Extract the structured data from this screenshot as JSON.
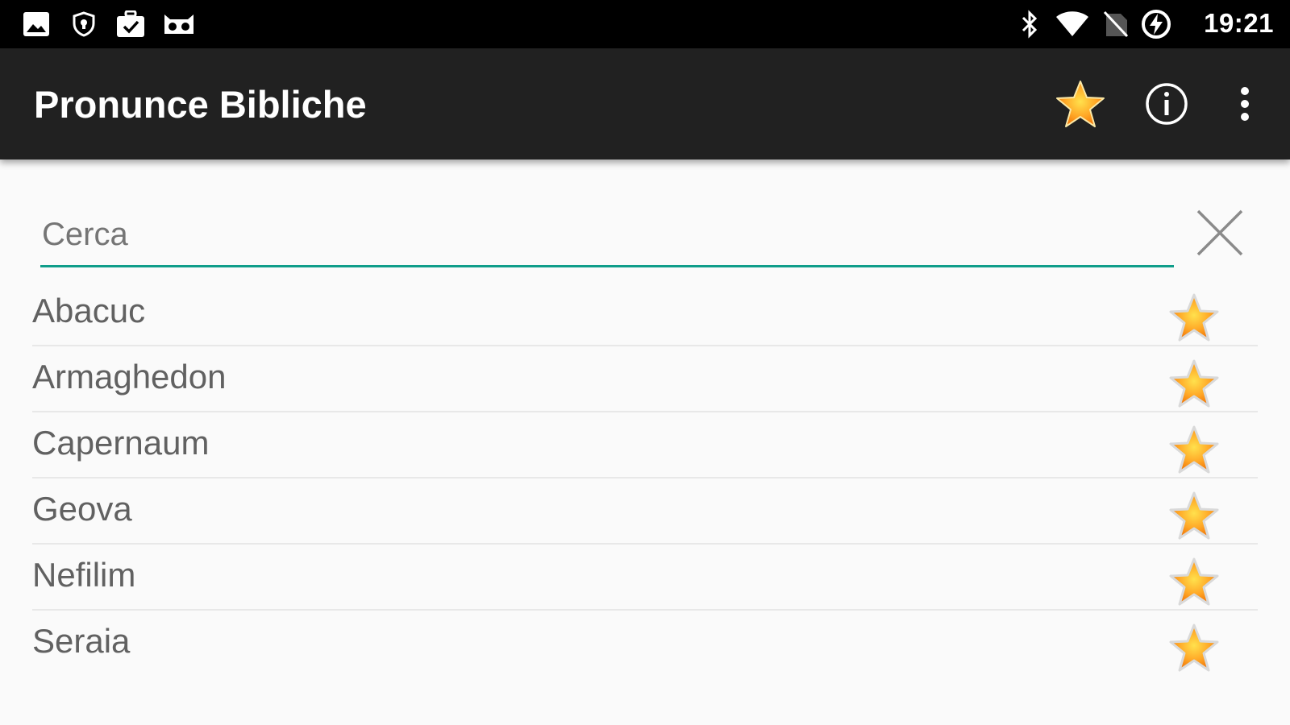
{
  "status_bar": {
    "time": "19:21",
    "left_icons": [
      "image-icon",
      "shield-icon",
      "briefcase-check-icon",
      "cat-face-icon"
    ],
    "right_icons": [
      "bluetooth-icon",
      "wifi-icon",
      "no-sim-icon",
      "battery-charging-icon"
    ]
  },
  "app_bar": {
    "title": "Pronunce Bibliche",
    "actions": [
      "star-icon",
      "info-icon",
      "overflow-menu-icon"
    ]
  },
  "search": {
    "placeholder": "Cerca",
    "value": ""
  },
  "list": {
    "items": [
      {
        "label": "Abacuc"
      },
      {
        "label": "Armaghedon"
      },
      {
        "label": "Capernaum"
      },
      {
        "label": "Geova"
      },
      {
        "label": "Nefilim"
      },
      {
        "label": "Seraia"
      }
    ]
  },
  "colors": {
    "status_bar_bg": "#000000",
    "app_bar_bg": "#212121",
    "accent_teal": "#0f9d8a",
    "star_orange": "#ff9800",
    "star_yellow": "#ffd54f",
    "text_gray": "#616161"
  }
}
